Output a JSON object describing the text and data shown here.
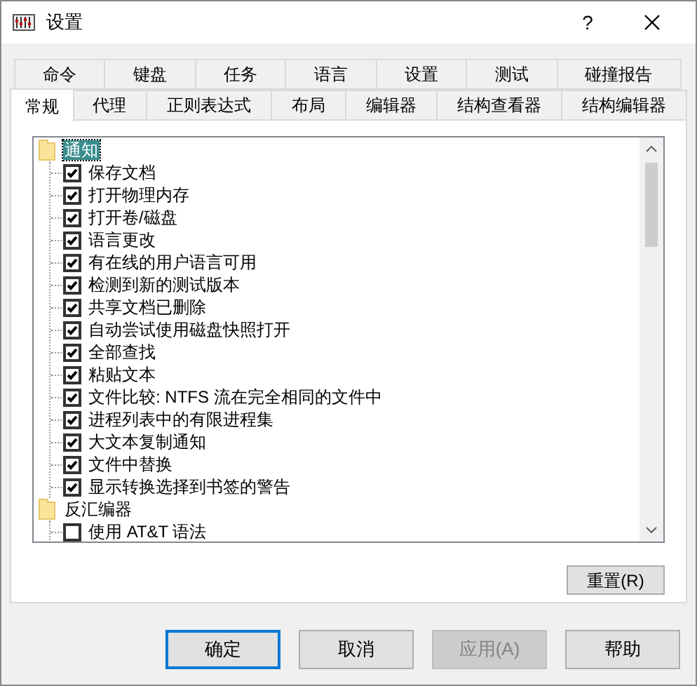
{
  "window": {
    "title": "设置",
    "help_button": "?"
  },
  "tab_rows": [
    {
      "tabs": [
        {
          "label": "命令",
          "selected": false
        },
        {
          "label": "键盘",
          "selected": false
        },
        {
          "label": "任务",
          "selected": false
        },
        {
          "label": "语言",
          "selected": false
        },
        {
          "label": "设置",
          "selected": false
        },
        {
          "label": "测试",
          "selected": false
        },
        {
          "label": "碰撞报告",
          "selected": false
        }
      ]
    },
    {
      "tabs": [
        {
          "label": "常规",
          "selected": true
        },
        {
          "label": "代理",
          "selected": false
        },
        {
          "label": "正则表达式",
          "selected": false
        },
        {
          "label": "布局",
          "selected": false
        },
        {
          "label": "编辑器",
          "selected": false
        },
        {
          "label": "结构查看器",
          "selected": false
        },
        {
          "label": "结构编辑器",
          "selected": false
        }
      ]
    }
  ],
  "tree": [
    {
      "label": "通知",
      "selected": true,
      "children": [
        {
          "label": "保存文档",
          "checked": true
        },
        {
          "label": "打开物理内存",
          "checked": true
        },
        {
          "label": "打开卷/磁盘",
          "checked": true
        },
        {
          "label": "语言更改",
          "checked": true
        },
        {
          "label": "有在线的用户语言可用",
          "checked": true
        },
        {
          "label": "检测到新的测试版本",
          "checked": true
        },
        {
          "label": "共享文档已删除",
          "checked": true
        },
        {
          "label": "自动尝试使用磁盘快照打开",
          "checked": true
        },
        {
          "label": "全部查找",
          "checked": true
        },
        {
          "label": "粘贴文本",
          "checked": true
        },
        {
          "label": "文件比较: NTFS 流在完全相同的文件中",
          "checked": true
        },
        {
          "label": "进程列表中的有限进程集",
          "checked": true
        },
        {
          "label": "大文本复制通知",
          "checked": true
        },
        {
          "label": "文件中替换",
          "checked": true
        },
        {
          "label": "显示转换选择到书签的警告",
          "checked": true
        }
      ]
    },
    {
      "label": "反汇编器",
      "selected": false,
      "children": [
        {
          "label": "使用 AT&T 语法",
          "checked": false
        }
      ]
    }
  ],
  "reset_button": "重置(R)",
  "buttons": [
    {
      "label": "确定",
      "default": true,
      "disabled": false
    },
    {
      "label": "取消",
      "default": false,
      "disabled": false
    },
    {
      "label": "应用(A)",
      "default": false,
      "disabled": true
    },
    {
      "label": "帮助",
      "default": false,
      "disabled": false
    }
  ]
}
